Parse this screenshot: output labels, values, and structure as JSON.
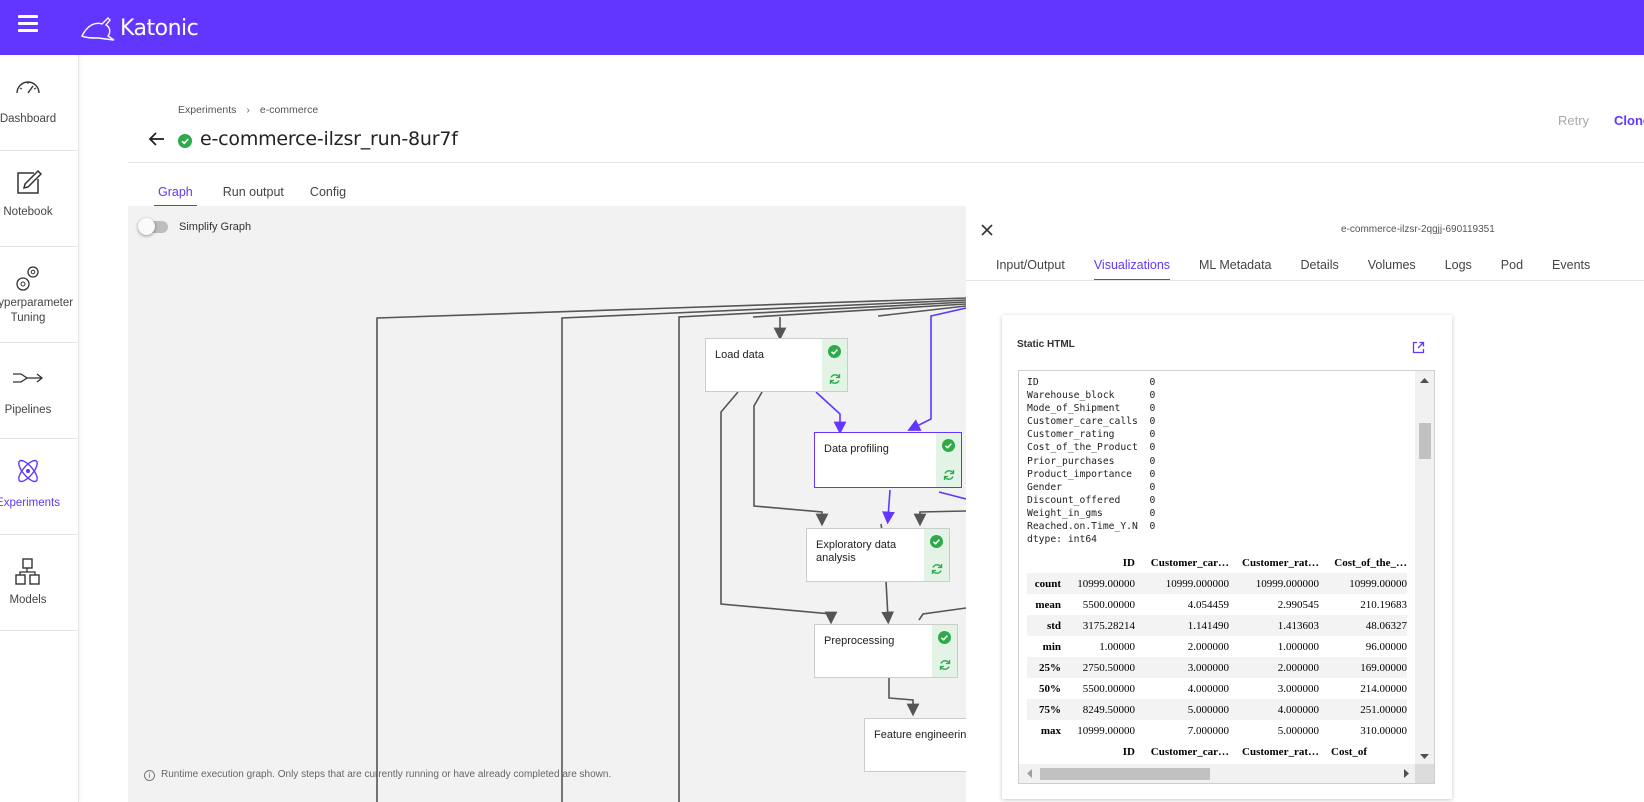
{
  "app": {
    "brand": "Katonic",
    "accent": "#6236ff"
  },
  "sidebar": {
    "items": [
      {
        "label": "Dashboard",
        "icon": "gauge-icon"
      },
      {
        "label": "Notebook",
        "icon": "edit-icon"
      },
      {
        "label": "Hyperparameter Tuning",
        "icon": "gears-icon"
      },
      {
        "label": "Pipelines",
        "icon": "pipeline-icon"
      },
      {
        "label": "Experiments",
        "icon": "atom-icon",
        "active": true
      },
      {
        "label": "Models",
        "icon": "models-icon"
      }
    ]
  },
  "breadcrumb": {
    "root": "Experiments",
    "current": "e-commerce"
  },
  "header": {
    "title": "e-commerce-ilzsr_run-8ur7f",
    "retry": "Retry",
    "clone": "Clone"
  },
  "tabs": [
    "Graph",
    "Run output",
    "Config"
  ],
  "graph": {
    "toggle_label": "Simplify Graph",
    "note": "Runtime execution graph. Only steps that are currently running or have already completed are shown.",
    "nodes": [
      "Load data",
      "Data profiling",
      "Exploratory data analysis",
      "Preprocessing",
      "Feature engineering"
    ]
  },
  "panel": {
    "run_id": "e-commerce-ilzsr-2qgjj-690119351",
    "tabs": [
      "Input/Output",
      "Visualizations",
      "ML Metadata",
      "Details",
      "Volumes",
      "Logs",
      "Pod",
      "Events"
    ],
    "card_title": "Static HTML",
    "series_text": "ID                   0\nWarehouse_block      0\nMode_of_Shipment     0\nCustomer_care_calls  0\nCustomer_rating      0\nCost_of_the_Product  0\nPrior_purchases      0\nProduct_importance   0\nGender               0\nDiscount_offered     0\nWeight_in_gms        0\nReached.on.Time_Y.N  0\ndtype: int64",
    "table": {
      "columns": [
        "",
        "ID",
        "Customer_car…",
        "Customer_rat…",
        "Cost_of_the_…"
      ],
      "rows": [
        [
          "count",
          "10999.00000",
          "10999.000000",
          "10999.000000",
          "10999.00000"
        ],
        [
          "mean",
          "5500.00000",
          "4.054459",
          "2.990545",
          "210.19683"
        ],
        [
          "std",
          "3175.28214",
          "1.141490",
          "1.413603",
          "48.06327"
        ],
        [
          "min",
          "1.00000",
          "2.000000",
          "1.000000",
          "96.00000"
        ],
        [
          "25%",
          "2750.50000",
          "3.000000",
          "2.000000",
          "169.00000"
        ],
        [
          "50%",
          "5500.00000",
          "4.000000",
          "3.000000",
          "214.00000"
        ],
        [
          "75%",
          "8249.50000",
          "5.000000",
          "4.000000",
          "251.00000"
        ],
        [
          "max",
          "10999.00000",
          "7.000000",
          "5.000000",
          "310.00000"
        ]
      ],
      "columns2": [
        "ID",
        "Customer_car…",
        "Customer_rat…",
        "Cost_of"
      ]
    }
  }
}
